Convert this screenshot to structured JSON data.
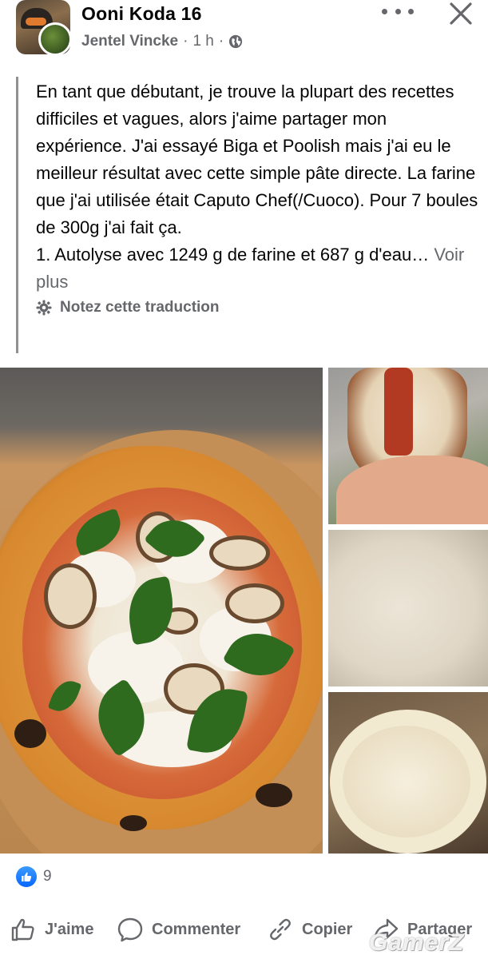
{
  "header": {
    "group_name": "Ooni Koda 16",
    "author": "Jentel Vincke",
    "separator": "·",
    "time": "1 h",
    "separator2": "·"
  },
  "post": {
    "text": "En tant que débutant, je trouve la plupart des recettes difficiles et vagues, alors j'aime partager mon expérience. J'ai essayé Biga et Poolish mais j'ai eu le meilleur résultat avec cette simple pâte directe. La farine que j'ai utilisée était Caputo Chef(/Cuoco). Pour 7 boules de 300g j'ai fait ça.",
    "line2": "1. Autolyse avec 1249 g de farine et 687 g d'eau…",
    "see_more": "Voir plus",
    "translate_label": "Notez cette traduction"
  },
  "reactions": {
    "count": "9"
  },
  "actions": {
    "like": "J'aime",
    "comment": "Commenter",
    "copy": "Copier",
    "share": "Partager"
  },
  "watermark": "GamerZ",
  "icons": [
    "more-icon",
    "close-icon",
    "globe-icon",
    "gear-icon",
    "like-icon",
    "comment-icon",
    "copy-icon",
    "share-icon"
  ],
  "colors": {
    "like_blue": "#0866ff",
    "secondary_text": "#65676b"
  }
}
